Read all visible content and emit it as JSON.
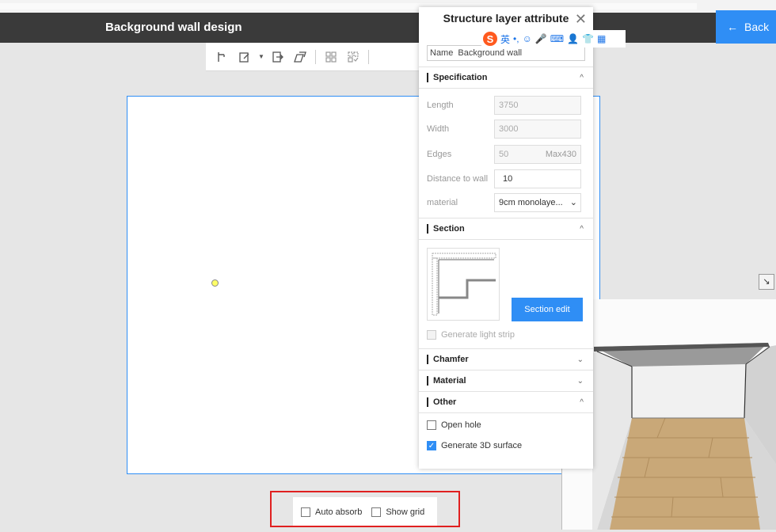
{
  "header": {
    "title": "Background wall design",
    "back_label": "Back"
  },
  "toolbar": {
    "icons": [
      "door-pin-icon",
      "edit-icon",
      "dropdown-icon",
      "export-icon",
      "copy-icon",
      "group-icon",
      "ungroup-icon"
    ]
  },
  "panel": {
    "title": "Structure layer attribute",
    "name_label": "Name",
    "name_value": "Background wall",
    "specification": {
      "title": "Specification",
      "fields": [
        {
          "label": "Length",
          "value": "3750"
        },
        {
          "label": "Width",
          "value": "3000"
        },
        {
          "label": "Edges",
          "value": "50",
          "suffix": "Max430"
        },
        {
          "label": "Distance to wall",
          "value": "10"
        },
        {
          "label": "material",
          "value": "9cm monolaye..."
        }
      ]
    },
    "section": {
      "title": "Section",
      "edit_button": "Section edit",
      "light_strip_label": "Generate light  strip"
    },
    "chamfer_title": "Chamfer",
    "material_title": "Material",
    "other": {
      "title": "Other",
      "open_hole_label": "Open hole",
      "open_hole_checked": false,
      "generate_3d_label": "Generate 3D surface",
      "generate_3d_checked": true
    }
  },
  "ime": {
    "lang": "英"
  },
  "bottom": {
    "auto_absorb": "Auto absorb",
    "show_grid": "Show grid"
  },
  "colors": {
    "accent": "#2f8ef5",
    "header_bg": "#3a3a3a",
    "highlight": "#e02020"
  }
}
